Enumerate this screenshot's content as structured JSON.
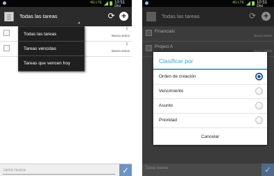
{
  "left_screen": {
    "status_bar": {
      "time": "10:51 PM",
      "network": "4G LTE"
    },
    "action_bar": {
      "title": "Todas las tareas"
    },
    "tasks": [
      {
        "priority": "!",
        "due": "Nunca vence"
      },
      {
        "priority": "!",
        "due": "Nunca vence"
      }
    ],
    "dropdown": {
      "items": [
        {
          "label": "Todas las tareas"
        },
        {
          "label": "Tareas vencidas"
        },
        {
          "label": "Tareas que vencen hoy"
        }
      ]
    },
    "bottom_bar": {
      "placeholder": "Tarea nueva"
    }
  },
  "right_screen": {
    "status_bar": {
      "time": "10:51 PM",
      "network": "4G LTE"
    },
    "action_bar": {
      "title": "Todas las tareas"
    },
    "tasks": [
      {
        "title": "Financials",
        "due": "Nunca vence"
      },
      {
        "title": "Project A",
        "due": "Nunca vence"
      }
    ],
    "bottom_bar": {
      "placeholder": "Tarea nueva"
    },
    "dialog": {
      "title": "Clasificar por",
      "options": [
        {
          "label": "Orden de creación",
          "selected": true
        },
        {
          "label": "Vencimiento",
          "selected": false
        },
        {
          "label": "Asunto",
          "selected": false
        },
        {
          "label": "Prioridad",
          "selected": false
        }
      ],
      "cancel_label": "Cancelar"
    }
  },
  "colors": {
    "action_bar": "#2b2b2b",
    "accent_blue": "#3ea2d8",
    "confirm_button": "#6b94c5",
    "radio_selected": "#1d5a9c"
  }
}
